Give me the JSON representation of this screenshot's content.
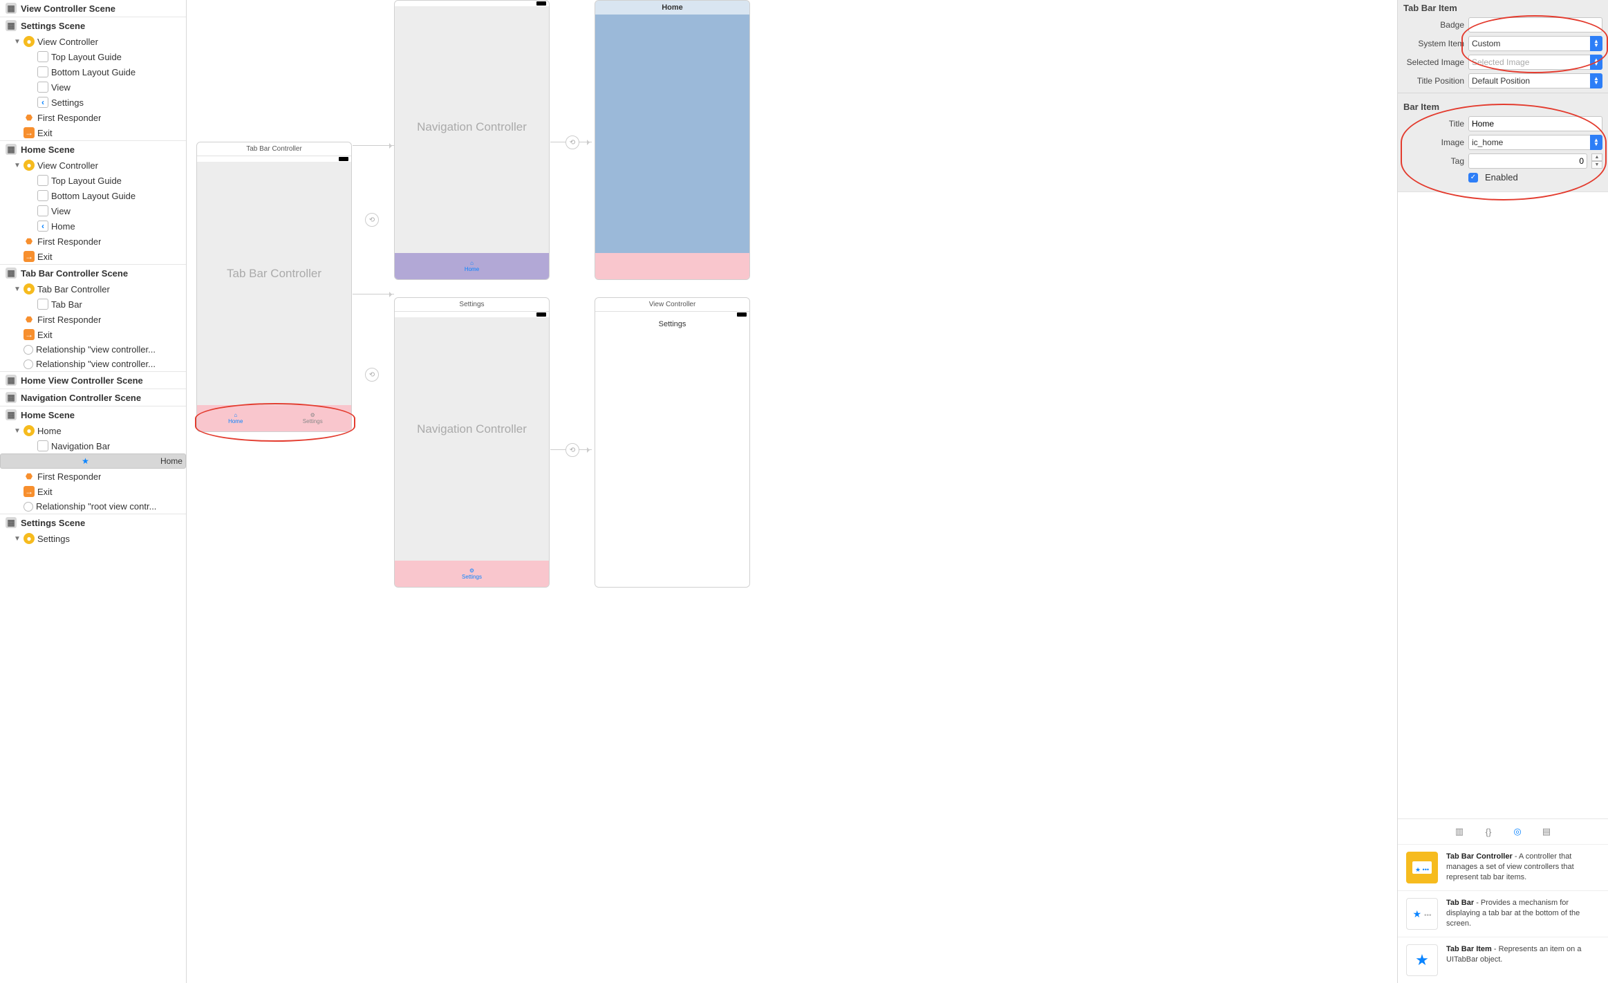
{
  "outline": {
    "scenes": [
      {
        "title": "View Controller Scene"
      },
      {
        "title": "Settings Scene",
        "rows": [
          {
            "ic": "vc",
            "indent": 1,
            "tw": "▼",
            "label": "View Controller"
          },
          {
            "ic": "guide",
            "indent": 2,
            "label": "Top Layout Guide"
          },
          {
            "ic": "guide",
            "indent": 2,
            "label": "Bottom Layout Guide"
          },
          {
            "ic": "guide",
            "indent": 2,
            "label": "View"
          },
          {
            "ic": "back",
            "indent": 2,
            "label": "Settings",
            "glyph": "‹"
          },
          {
            "ic": "cube",
            "indent": 1,
            "label": "First Responder"
          },
          {
            "ic": "exit",
            "indent": 1,
            "label": "Exit"
          }
        ]
      },
      {
        "title": "Home Scene",
        "rows": [
          {
            "ic": "vc",
            "indent": 1,
            "tw": "▼",
            "label": "View Controller"
          },
          {
            "ic": "guide",
            "indent": 2,
            "label": "Top Layout Guide"
          },
          {
            "ic": "guide",
            "indent": 2,
            "label": "Bottom Layout Guide"
          },
          {
            "ic": "guide",
            "indent": 2,
            "label": "View"
          },
          {
            "ic": "back",
            "indent": 2,
            "label": "Home",
            "glyph": "‹"
          },
          {
            "ic": "cube",
            "indent": 1,
            "label": "First Responder"
          },
          {
            "ic": "exit",
            "indent": 1,
            "label": "Exit"
          }
        ]
      },
      {
        "title": "Tab Bar Controller Scene",
        "rows": [
          {
            "ic": "vc",
            "indent": 1,
            "tw": "▼",
            "label": "Tab Bar Controller"
          },
          {
            "ic": "tab",
            "indent": 2,
            "label": "Tab Bar"
          },
          {
            "ic": "cube",
            "indent": 1,
            "label": "First Responder"
          },
          {
            "ic": "exit",
            "indent": 1,
            "label": "Exit"
          },
          {
            "ic": "circ",
            "indent": 1,
            "label": "Relationship \"view controller..."
          },
          {
            "ic": "circ",
            "indent": 1,
            "label": "Relationship \"view controller..."
          }
        ]
      },
      {
        "title": "Home View Controller Scene"
      },
      {
        "title": "Navigation Controller Scene"
      },
      {
        "title": "Home Scene",
        "rows": [
          {
            "ic": "vc",
            "indent": 1,
            "tw": "▼",
            "label": "Home",
            "variant": "back-yellow"
          },
          {
            "ic": "guide",
            "indent": 2,
            "label": "Navigation Bar"
          },
          {
            "ic": "star",
            "indent": 2,
            "label": "Home",
            "selected": true
          },
          {
            "ic": "cube",
            "indent": 1,
            "label": "First Responder"
          },
          {
            "ic": "exit",
            "indent": 1,
            "label": "Exit"
          },
          {
            "ic": "circ",
            "indent": 1,
            "label": "Relationship \"root view contr..."
          }
        ]
      },
      {
        "title": "Settings Scene",
        "rows": [
          {
            "ic": "vc",
            "indent": 1,
            "tw": "▼",
            "label": "Settings",
            "variant": "back-yellow"
          }
        ]
      }
    ]
  },
  "canvas": {
    "tabbar_title": "Tab Bar Controller",
    "tabbar_center": "Tab Bar Controller",
    "tabbar_tabs": [
      {
        "label": "Home",
        "active": true,
        "icon": "home"
      },
      {
        "label": "Settings",
        "active": false,
        "icon": "gear"
      }
    ],
    "nav1_title": "Navigation Controller",
    "nav1_tab_label": "Home",
    "nav2_title": "Settings",
    "nav2_center": "Navigation Controller",
    "nav2_tab_label": "Settings",
    "home_nav_title": "Home",
    "settings_title": "View Controller",
    "settings_nav": "Settings"
  },
  "inspector": {
    "section1": "Tab Bar Item",
    "badge_label": "Badge",
    "badge_value": "",
    "system_item_label": "System Item",
    "system_item_value": "Custom",
    "selected_image_label": "Selected Image",
    "selected_image_placeholder": "Selected Image",
    "title_position_label": "Title Position",
    "title_position_value": "Default Position",
    "section2": "Bar Item",
    "title_label": "Title",
    "title_value": "Home",
    "image_label": "Image",
    "image_value": "ic_home",
    "tag_label": "Tag",
    "tag_value": "0",
    "enabled_label": "Enabled"
  },
  "library": {
    "items": [
      {
        "title": "Tab Bar Controller",
        "desc": " - A controller that manages a set of view controllers that represent tab bar items.",
        "thumb": "gold"
      },
      {
        "title": "Tab Bar",
        "desc": " - Provides a mechanism for displaying a tab bar at the bottom of the screen.",
        "thumb": "star-dots"
      },
      {
        "title": "Tab Bar Item",
        "desc": " - Represents an item on a UITabBar object.",
        "thumb": "star"
      }
    ]
  }
}
